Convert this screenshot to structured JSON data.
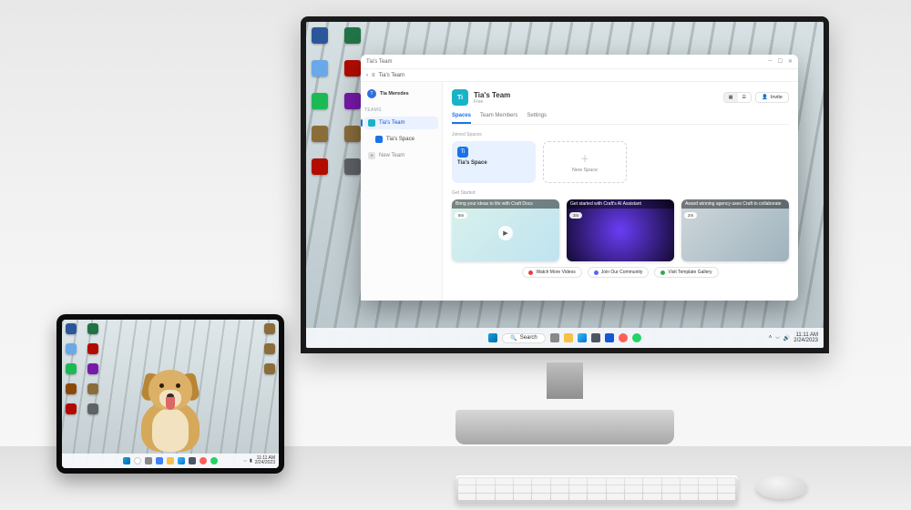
{
  "scene": {
    "description": "Product photo: Surface Studio-style monitor and a tablet on a light desk. Both run Windows 11. Monitor shows a snowy-forest wallpaper with a Craft-like teams app open. Tablet shows the same forest wallpaper with a golden retriever."
  },
  "monitor": {
    "taskbar": {
      "search_placeholder": "Search",
      "time": "11:11 AM",
      "date": "2/24/2023"
    },
    "desktop_icons": [
      {
        "name": "word",
        "color": "#2b579a"
      },
      {
        "name": "excel",
        "color": "#217346"
      },
      {
        "name": "notepad",
        "color": "#6aa9e9"
      },
      {
        "name": "acrobat",
        "color": "#b30b00"
      },
      {
        "name": "spotify",
        "color": "#1db954"
      },
      {
        "name": "onenote",
        "color": "#7719aa"
      },
      {
        "name": "image",
        "color": "#8a6d3b"
      },
      {
        "name": "image-2",
        "color": "#8a6d3b"
      },
      {
        "name": "acrobat-2",
        "color": "#b30b00"
      },
      {
        "name": "program",
        "color": "#5f6368"
      }
    ]
  },
  "app": {
    "title": "Tia's Team",
    "breadcrumb": "Tia's Team",
    "user": {
      "initials": "T",
      "name": "Tia Meredes"
    },
    "sidebar": {
      "section_label": "Teams",
      "items": [
        {
          "icon_color": "#19b3c7",
          "label": "Tia's Team",
          "sub": "",
          "selected": true
        },
        {
          "icon_color": "#1a73e8",
          "label": "Tia's Space",
          "sub": "",
          "selected": false
        },
        {
          "icon_color": "#9aa0a6",
          "label": "New Team",
          "sub": "",
          "selected": false,
          "is_new": true
        }
      ]
    },
    "header": {
      "team_initials": "Ti",
      "team_name": "Tia's Team",
      "team_plan": "Free",
      "view_toggle": [
        "grid",
        "list"
      ],
      "invite_label": "Invite"
    },
    "tabs": [
      "Spaces",
      "Team Members",
      "Settings"
    ],
    "active_tab": "Spaces",
    "joined_label": "Joined Spaces",
    "spaces": [
      {
        "initials": "Ti",
        "name": "Tia's Space"
      }
    ],
    "new_space_label": "New Space",
    "get_started_label": "Get Started",
    "docs": [
      {
        "title": "Bring your ideas to life with Craft Docs",
        "chip": "8m",
        "bg": "linear-gradient(135deg,#d9f1ec,#bfe3ef)"
      },
      {
        "title": "Get started with Craft's AI Assistant",
        "chip": "3m",
        "bg": "radial-gradient(circle at 50% 50%,#6a3df5,#140a33)"
      },
      {
        "title": "Award winning agency uses Craft to collaborate",
        "chip": "2m",
        "bg": "linear-gradient(135deg,#cfd8dc,#9fb3bd)"
      }
    ],
    "footer_links": [
      {
        "dot": "#e8413a",
        "label": "Watch More Videos"
      },
      {
        "dot": "#5865f2",
        "label": "Join Our Community"
      },
      {
        "dot": "#34a853",
        "label": "Visit Template Gallery"
      }
    ]
  },
  "tablet": {
    "taskbar": {
      "time": "11:11 AM",
      "date": "2/24/2023"
    },
    "desktop_icons_left": [
      {
        "name": "word",
        "color": "#2b579a"
      },
      {
        "name": "excel",
        "color": "#217346"
      },
      {
        "name": "notepad",
        "color": "#6aa9e9"
      },
      {
        "name": "acrobat",
        "color": "#b30b00"
      },
      {
        "name": "spotify",
        "color": "#1db954"
      },
      {
        "name": "onenote",
        "color": "#7719aa"
      },
      {
        "name": "winrar",
        "color": "#8a4b08"
      },
      {
        "name": "image",
        "color": "#8a6d3b"
      },
      {
        "name": "acrobat-2",
        "color": "#b30b00"
      },
      {
        "name": "program",
        "color": "#5f6368"
      }
    ],
    "desktop_icons_right": [
      {
        "name": "image",
        "color": "#8a6d3b"
      },
      {
        "name": "image-2",
        "color": "#8a6d3b"
      },
      {
        "name": "image-3",
        "color": "#8a6d3b"
      }
    ]
  },
  "colors": {
    "win_accent": "#0078d4",
    "craft_blue": "#1a73e8",
    "craft_teal": "#19b3c7"
  }
}
